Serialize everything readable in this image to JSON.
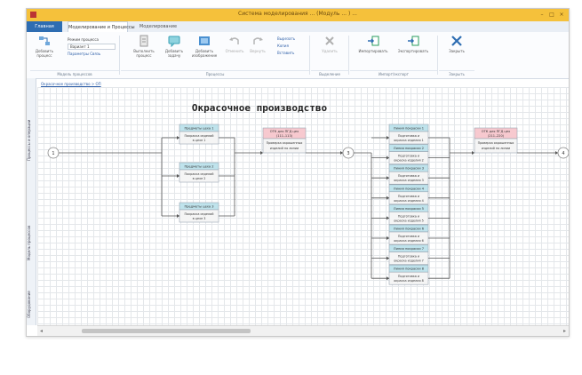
{
  "window": {
    "title": "Система моделирования ... (Модуль ... ) ... ",
    "buttons": {
      "minimize": "–",
      "maximize": "□",
      "close": "×"
    }
  },
  "tabs": [
    {
      "label": "Главная"
    },
    {
      "label": "Моделирование и Процессы"
    },
    {
      "label": "Моделирование"
    }
  ],
  "ribbon": {
    "buttons": [
      {
        "label": "Добавить процесс",
        "icon": "flow-icon"
      },
      {
        "label": "Исходный процесс",
        "icon": "list-icon"
      },
      {
        "label": "Выполнить процесс",
        "icon": "document-icon"
      },
      {
        "label": "Добавить задачу",
        "icon": "comment-icon"
      },
      {
        "label": "Добавить изображение",
        "icon": "image-icon"
      },
      {
        "label": "Отменить",
        "icon": "undo-icon"
      },
      {
        "label": "Вернуть",
        "icon": "redo-icon"
      },
      {
        "label": "Удалить",
        "icon": "delete-icon"
      },
      {
        "label": "Импортировать",
        "icon": "import-icon"
      },
      {
        "label": "Экспортировать",
        "icon": "export-icon"
      },
      {
        "label": "Закрыть",
        "icon": "close-icon"
      }
    ],
    "small_rows": [
      "Режим процесса",
      "Вариант 1",
      "Параметры  Связь",
      "Вырезать",
      "Копия",
      "Вставить"
    ],
    "groups": [
      "Модель процессов",
      "Процессы",
      "Выделение",
      "Импорт/экспорт",
      "Закрыть"
    ]
  },
  "breadcrumb": "Окрасочное производство > ОП",
  "side_tabs": [
    "Процессы и операции",
    "Модель процессов",
    "Оборудование"
  ],
  "diagram": {
    "title": "Окрасочное производство",
    "start_node": "1",
    "mid_node": "3",
    "end_node": "4",
    "left_branches": [
      {
        "header": "Предметы цеха 1",
        "body": "Покраска изделий в цехе 1"
      },
      {
        "header": "Предметы цеха 2",
        "body": "Покраска изделий в цехе 2"
      },
      {
        "header": "Предметы цеха 3",
        "body": "Покраска изделий в цехе 3"
      }
    ],
    "left_merge": {
      "header": "ОТК для ПГД цех (111–113)",
      "body": "Проверка окрашенных изделий по линии"
    },
    "right_branches": [
      {
        "header": "Линия покраски 1",
        "body": "Подготовка и окраска изделия 1"
      },
      {
        "header": "Линия покраски 2",
        "body": "Подготовка и окраска изделия 2"
      },
      {
        "header": "Линия покраски 3",
        "body": "Подготовка и окраска изделия 3"
      },
      {
        "header": "Линия покраски 4",
        "body": "Подготовка и окраска изделия 4"
      },
      {
        "header": "Линия покраски 5",
        "body": "Подготовка и окраска изделия 5"
      },
      {
        "header": "Линия покраски 6",
        "body": "Подготовка и окраска изделия 6"
      },
      {
        "header": "Линия покраски 7",
        "body": "Подготовка и окраска изделия 7"
      },
      {
        "header": "Линия покраски 8",
        "body": "Подготовка и окраска изделия 8"
      }
    ],
    "right_merge": {
      "header": "ОТК для ПГД цех (211–220)",
      "body": "Проверка окрашенных изделий по линии"
    }
  },
  "colors": {
    "titlebar": "#f5c13b",
    "file_tab": "#2e6db2",
    "header_blue": "#bfe3ec",
    "header_pink": "#f7c9cf",
    "node_border": "#9aa6b2",
    "connector": "#555555"
  }
}
